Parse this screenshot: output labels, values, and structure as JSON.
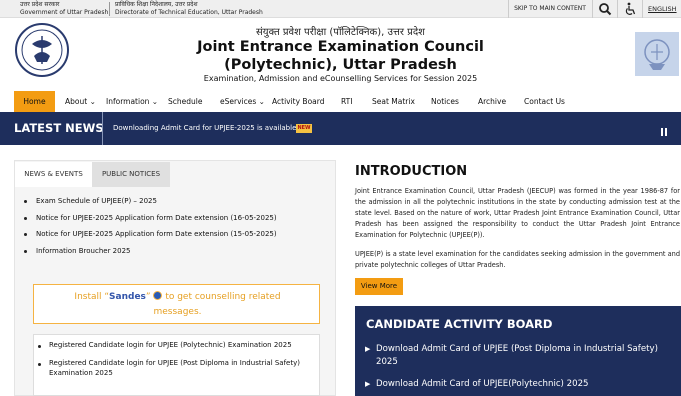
{
  "top_bar": {
    "gov_hindi_1": "उत्तर प्रदेश सरकार",
    "gov_eng_1": "Government of Uttar Pradesh",
    "gov_hindi_2": "प्राविधिक शिक्षा निदेशालय, उत्तर प्रदेश",
    "gov_eng_2": "Directorate of Technical Education, Uttar Pradesh",
    "skip_label": "SKIP TO MAIN CONTENT",
    "language_label": "ENGLISH"
  },
  "header": {
    "hindi_title": "संयुक्त प्रवेश परीक्षा (पॉलिटेक्निक), उत्तर प्रदेश",
    "title_line1": "Joint Entrance Examination Council",
    "title_line2": "(Polytechnic), Uttar Pradesh",
    "subtitle": "Examination, Admission and eCounselling Services for Session 2025"
  },
  "nav": {
    "items": [
      {
        "label": "Home"
      },
      {
        "label": "About"
      },
      {
        "label": "Information"
      },
      {
        "label": "Schedule"
      },
      {
        "label": "eServices"
      },
      {
        "label": "Activity Board"
      },
      {
        "label": "RTI"
      },
      {
        "label": "Seat Matrix"
      },
      {
        "label": "Notices"
      },
      {
        "label": "Archive"
      },
      {
        "label": "Contact Us"
      }
    ],
    "active_color": "#f39c12"
  },
  "latest_news": {
    "label": "LATEST NEWS",
    "ticker_text": "Downloading Admit Card for UPJEE-2025 is available.",
    "badge": "NEW",
    "bar_color": "#1e2e5c"
  },
  "tabs": {
    "news_events": "NEWS & EVENTS",
    "public_notices": "PUBLIC NOTICES"
  },
  "news_list": [
    "Exam Schedule of UPJEE(P) – 2025",
    "Notice for UPJEE-2025 Application form Date extension (16-05-2025)",
    "Notice for UPJEE-2025 Application form Date extension (15-05-2025)",
    "Information Broucher 2025"
  ],
  "sandes": {
    "prefix": "Install “",
    "name": "Sandes",
    "suffix": "” ",
    "line1_tail": " to get counselling related",
    "line2": "messages."
  },
  "logins": [
    "Registered Candidate login for UPJEE (Polytechnic) Examination 2025",
    "Registered Candidate login for UPJEE (Post Diploma in Industrial Safety) Examination 2025"
  ],
  "introduction": {
    "title": "INTRODUCTION",
    "para1": "Joint Entrance Examination Council, Uttar Pradesh (JEECUP) was formed in the year 1986-87 for the admission in all the polytechnic institutions in the state by conducting admission test at the state level. Based on the nature of work, Uttar Pradesh Joint Entrance Examination Council, Uttar Pradesh has been assigned the responsibility to conduct the Uttar Pradesh Joint Entrance Examination for Polytechnic (UPJEE(P)).",
    "para2": "UPJEE(P) is a state level examination for the candidates seeking admission in the government and private polytechnic colleges of Uttar Pradesh.",
    "view_more": "View More"
  },
  "candidate_board": {
    "title": "CANDIDATE ACTIVITY BOARD",
    "items": [
      "Download Admit Card of UPJEE (Post Diploma in Industrial Safety) 2025",
      "Download Admit Card of UPJEE(Polytechnic) 2025"
    ]
  }
}
